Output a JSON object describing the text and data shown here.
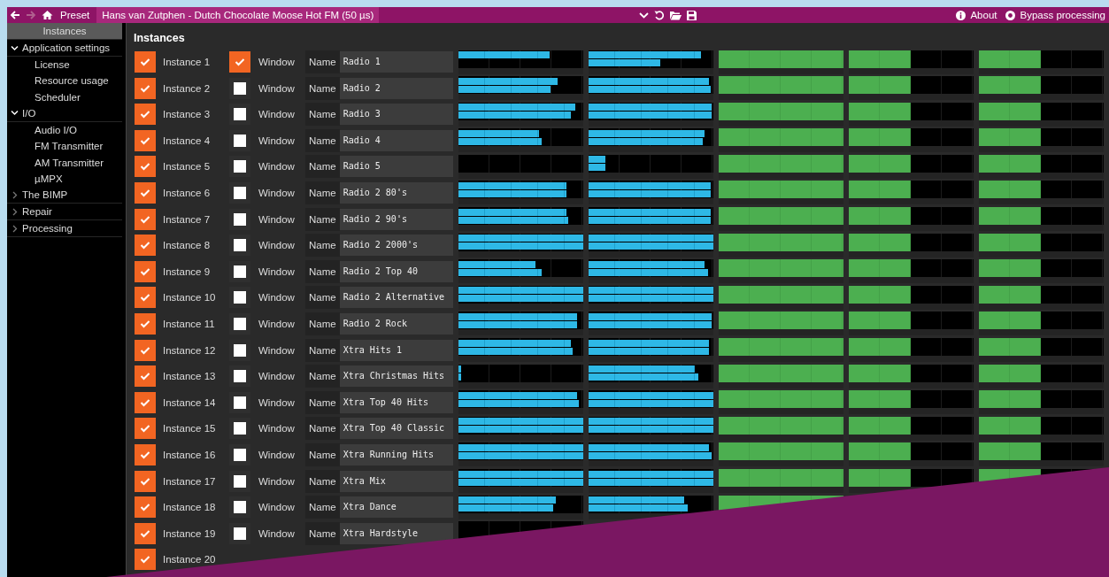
{
  "title_bar": {
    "preset_label": "Preset",
    "preset_name": "Hans van Zutphen - Dutch Chocolate Moose Hot FM (50 µs)",
    "about": "About",
    "bypass": "Bypass processing"
  },
  "sidebar": {
    "items": [
      {
        "label": "Instances",
        "selected": true
      },
      {
        "label": "Application settings",
        "selected": false,
        "expanded": true,
        "children": [
          {
            "label": "License",
            "selected": false
          },
          {
            "label": "Resource usage",
            "selected": false
          },
          {
            "label": "Scheduler",
            "selected": false
          }
        ]
      },
      {
        "label": "I/O",
        "selected": false,
        "expanded": true,
        "children": [
          {
            "label": "Audio I/O",
            "selected": false
          },
          {
            "label": "FM Transmitter",
            "selected": false
          },
          {
            "label": "AM Transmitter",
            "selected": false
          },
          {
            "label": "µMPX",
            "selected": false
          }
        ]
      },
      {
        "label": "The BIMP",
        "selected": false,
        "expanded": false
      },
      {
        "label": "Repair",
        "selected": false,
        "expanded": false
      },
      {
        "label": "Processing",
        "selected": false,
        "expanded": false
      }
    ]
  },
  "panel": {
    "title": "Instances",
    "rows": [
      {
        "label": "Instance 1",
        "enabled": true,
        "window": true,
        "window_label": "Window",
        "name_label": "Name",
        "name": "Radio 1",
        "meters": [
          {
            "kind": "stereo",
            "channels": [
              {
                "level": 0.73
              },
              {
                "level": 0
              }
            ]
          },
          {
            "kind": "stereo",
            "channels": [
              {
                "level": 0.9
              },
              {
                "level": 0.58
              }
            ]
          },
          {
            "kind": "mono",
            "level": 1
          },
          {
            "kind": "mono",
            "level": 0.5
          },
          {
            "kind": "mono",
            "level": 0.5
          }
        ]
      },
      {
        "label": "Instance 2",
        "enabled": true,
        "window": false,
        "window_label": "Window",
        "name_label": "Name",
        "name": "Radio 2",
        "meters": [
          {
            "kind": "stereo",
            "channels": [
              {
                "level": 0.8
              },
              {
                "level": 0.74
              }
            ]
          },
          {
            "kind": "stereo",
            "channels": [
              {
                "level": 0.97
              },
              {
                "level": 0.98
              }
            ]
          },
          {
            "kind": "mono",
            "level": 1
          },
          {
            "kind": "mono",
            "level": 0.5
          },
          {
            "kind": "mono",
            "level": 0.5
          }
        ]
      },
      {
        "label": "Instance 3",
        "enabled": true,
        "window": false,
        "window_label": "Window",
        "name_label": "Name",
        "name": "Radio 3",
        "meters": [
          {
            "kind": "stereo",
            "channels": [
              {
                "level": 0.94
              },
              {
                "level": 0.9
              }
            ]
          },
          {
            "kind": "stereo",
            "channels": [
              {
                "level": 0.99
              },
              {
                "level": 0.99
              }
            ]
          },
          {
            "kind": "mono",
            "level": 1
          },
          {
            "kind": "mono",
            "level": 0.5
          },
          {
            "kind": "mono",
            "level": 0.5
          }
        ]
      },
      {
        "label": "Instance 4",
        "enabled": true,
        "window": false,
        "window_label": "Window",
        "name_label": "Name",
        "name": "Radio 4",
        "meters": [
          {
            "kind": "stereo",
            "channels": [
              {
                "level": 0.65
              },
              {
                "level": 0.67
              }
            ]
          },
          {
            "kind": "stereo",
            "channels": [
              {
                "level": 0.93
              },
              {
                "level": 0.92
              }
            ]
          },
          {
            "kind": "mono",
            "level": 1
          },
          {
            "kind": "mono",
            "level": 0.5
          },
          {
            "kind": "mono",
            "level": 0.5
          }
        ]
      },
      {
        "label": "Instance 5",
        "enabled": true,
        "window": false,
        "window_label": "Window",
        "name_label": "Name",
        "name": "Radio 5",
        "meters": [
          {
            "kind": "stereo",
            "channels": [
              {
                "level": 0
              },
              {
                "level": 0
              }
            ]
          },
          {
            "kind": "stereo",
            "channels": [
              {
                "level": 0.14
              },
              {
                "level": 0.14
              }
            ]
          },
          {
            "kind": "mono",
            "level": 1
          },
          {
            "kind": "mono",
            "level": 0.5
          },
          {
            "kind": "mono",
            "level": 0.5
          }
        ]
      },
      {
        "label": "Instance 6",
        "enabled": true,
        "window": false,
        "window_label": "Window",
        "name_label": "Name",
        "name": "Radio 2 80's",
        "meters": [
          {
            "kind": "stereo",
            "channels": [
              {
                "level": 0.87
              },
              {
                "level": 0.87
              }
            ]
          },
          {
            "kind": "stereo",
            "channels": [
              {
                "level": 0.98
              },
              {
                "level": 0.98
              }
            ]
          },
          {
            "kind": "mono",
            "level": 1
          },
          {
            "kind": "mono",
            "level": 0.5
          },
          {
            "kind": "mono",
            "level": 0.5
          }
        ]
      },
      {
        "label": "Instance 7",
        "enabled": true,
        "window": false,
        "window_label": "Window",
        "name_label": "Name",
        "name": "Radio 2 90's",
        "meters": [
          {
            "kind": "stereo",
            "channels": [
              {
                "level": 0.87
              },
              {
                "level": 0.88
              }
            ]
          },
          {
            "kind": "stereo",
            "channels": [
              {
                "level": 0.98
              },
              {
                "level": 0.98
              }
            ]
          },
          {
            "kind": "mono",
            "level": 1
          },
          {
            "kind": "mono",
            "level": 0.5
          },
          {
            "kind": "mono",
            "level": 0.5
          }
        ]
      },
      {
        "label": "Instance 8",
        "enabled": true,
        "window": false,
        "window_label": "Window",
        "name_label": "Name",
        "name": "Radio 2 2000's",
        "meters": [
          {
            "kind": "stereo",
            "channels": [
              {
                "level": 1
              },
              {
                "level": 1
              }
            ]
          },
          {
            "kind": "stereo",
            "channels": [
              {
                "level": 1
              },
              {
                "level": 1
              }
            ]
          },
          {
            "kind": "mono",
            "level": 1
          },
          {
            "kind": "mono",
            "level": 0.5
          },
          {
            "kind": "mono",
            "level": 0.5
          }
        ]
      },
      {
        "label": "Instance 9",
        "enabled": true,
        "window": false,
        "window_label": "Window",
        "name_label": "Name",
        "name": "Radio 2 Top 40",
        "meters": [
          {
            "kind": "stereo",
            "channels": [
              {
                "level": 0.62
              },
              {
                "level": 0.67
              }
            ]
          },
          {
            "kind": "stereo",
            "channels": [
              {
                "level": 0.93
              },
              {
                "level": 0.96
              }
            ]
          },
          {
            "kind": "mono",
            "level": 1
          },
          {
            "kind": "mono",
            "level": 0.5
          },
          {
            "kind": "mono",
            "level": 0.5
          }
        ]
      },
      {
        "label": "Instance 10",
        "enabled": true,
        "window": false,
        "window_label": "Window",
        "name_label": "Name",
        "name": "Radio 2 Alternative",
        "meters": [
          {
            "kind": "stereo",
            "channels": [
              {
                "level": 1
              },
              {
                "level": 1
              }
            ]
          },
          {
            "kind": "stereo",
            "channels": [
              {
                "level": 1
              },
              {
                "level": 1
              }
            ]
          },
          {
            "kind": "mono",
            "level": 1
          },
          {
            "kind": "mono",
            "level": 0.5
          },
          {
            "kind": "mono",
            "level": 0.5
          }
        ]
      },
      {
        "label": "Instance 11",
        "enabled": true,
        "window": false,
        "window_label": "Window",
        "name_label": "Name",
        "name": "Radio 2 Rock",
        "meters": [
          {
            "kind": "stereo",
            "channels": [
              {
                "level": 0.95
              },
              {
                "level": 0.95
              }
            ]
          },
          {
            "kind": "stereo",
            "channels": [
              {
                "level": 0.99
              },
              {
                "level": 0.99
              }
            ]
          },
          {
            "kind": "mono",
            "level": 1
          },
          {
            "kind": "mono",
            "level": 0.5
          },
          {
            "kind": "mono",
            "level": 0.5
          }
        ]
      },
      {
        "label": "Instance 12",
        "enabled": true,
        "window": false,
        "window_label": "Window",
        "name_label": "Name",
        "name": "Xtra Hits 1",
        "meters": [
          {
            "kind": "stereo",
            "channels": [
              {
                "level": 0.9
              },
              {
                "level": 0.92
              }
            ]
          },
          {
            "kind": "stereo",
            "channels": [
              {
                "level": 0.97
              },
              {
                "level": 0.97
              }
            ]
          },
          {
            "kind": "mono",
            "level": 1
          },
          {
            "kind": "mono",
            "level": 0.5
          },
          {
            "kind": "mono",
            "level": 0.5
          }
        ]
      },
      {
        "label": "Instance 13",
        "enabled": true,
        "window": false,
        "window_label": "Window",
        "name_label": "Name",
        "name": "Xtra Christmas Hits",
        "meters": [
          {
            "kind": "stereo",
            "channels": [
              {
                "level": 0.02
              },
              {
                "level": 0.02
              }
            ]
          },
          {
            "kind": "stereo",
            "channels": [
              {
                "level": 0.85
              },
              {
                "level": 0.88
              }
            ]
          },
          {
            "kind": "mono",
            "level": 1
          },
          {
            "kind": "mono",
            "level": 0.5
          },
          {
            "kind": "mono",
            "level": 0.5
          }
        ]
      },
      {
        "label": "Instance 14",
        "enabled": true,
        "window": false,
        "window_label": "Window",
        "name_label": "Name",
        "name": "Xtra Top 40 Hits",
        "meters": [
          {
            "kind": "stereo",
            "channels": [
              {
                "level": 0.95
              },
              {
                "level": 0.97
              }
            ]
          },
          {
            "kind": "stereo",
            "channels": [
              {
                "level": 1
              },
              {
                "level": 1
              }
            ]
          },
          {
            "kind": "mono",
            "level": 1
          },
          {
            "kind": "mono",
            "level": 0.5
          },
          {
            "kind": "mono",
            "level": 0.5
          }
        ]
      },
      {
        "label": "Instance 15",
        "enabled": true,
        "window": false,
        "window_label": "Window",
        "name_label": "Name",
        "name": "Xtra Top 40 Classic",
        "meters": [
          {
            "kind": "stereo",
            "channels": [
              {
                "level": 1
              },
              {
                "level": 1
              }
            ]
          },
          {
            "kind": "stereo",
            "channels": [
              {
                "level": 1
              },
              {
                "level": 1
              }
            ]
          },
          {
            "kind": "mono",
            "level": 1
          },
          {
            "kind": "mono",
            "level": 0.5
          },
          {
            "kind": "mono",
            "level": 0.5
          }
        ]
      },
      {
        "label": "Instance 16",
        "enabled": true,
        "window": false,
        "window_label": "Window",
        "name_label": "Name",
        "name": "Xtra Running Hits",
        "meters": [
          {
            "kind": "stereo",
            "channels": [
              {
                "level": 1
              },
              {
                "level": 1
              }
            ]
          },
          {
            "kind": "stereo",
            "channels": [
              {
                "level": 0.97
              },
              {
                "level": 0.99
              }
            ]
          },
          {
            "kind": "mono",
            "level": 1
          },
          {
            "kind": "mono",
            "level": 0.5
          },
          {
            "kind": "mono",
            "level": 0.5
          }
        ]
      },
      {
        "label": "Instance 17",
        "enabled": true,
        "window": false,
        "window_label": "Window",
        "name_label": "Name",
        "name": "Xtra Mix",
        "meters": [
          {
            "kind": "stereo",
            "channels": [
              {
                "level": 1
              },
              {
                "level": 1
              }
            ]
          },
          {
            "kind": "stereo",
            "channels": [
              {
                "level": 1
              },
              {
                "level": 1
              }
            ]
          },
          {
            "kind": "mono",
            "level": 1
          },
          {
            "kind": "mono",
            "level": 0.5
          },
          {
            "kind": "mono",
            "level": 0.5
          }
        ]
      },
      {
        "label": "Instance 18",
        "enabled": true,
        "window": false,
        "window_label": "Window",
        "name_label": "Name",
        "name": "Xtra Dance",
        "meters": [
          {
            "kind": "stereo",
            "channels": [
              {
                "level": 0.78
              },
              {
                "level": 0.76
              }
            ]
          },
          {
            "kind": "stereo",
            "channels": [
              {
                "level": 0.77
              },
              {
                "level": 0.8
              }
            ]
          },
          {
            "kind": "mono",
            "level": 1
          }
        ]
      },
      {
        "label": "Instance 19",
        "enabled": true,
        "window": false,
        "window_label": "Window",
        "name_label": "Name",
        "name": "Xtra Hardstyle",
        "meters": [
          {
            "kind": "stereo",
            "channels": [
              {
                "level": 0
              },
              {
                "level": 0
              }
            ]
          }
        ]
      },
      {
        "label": "Instance 20",
        "enabled": true
      }
    ]
  }
}
